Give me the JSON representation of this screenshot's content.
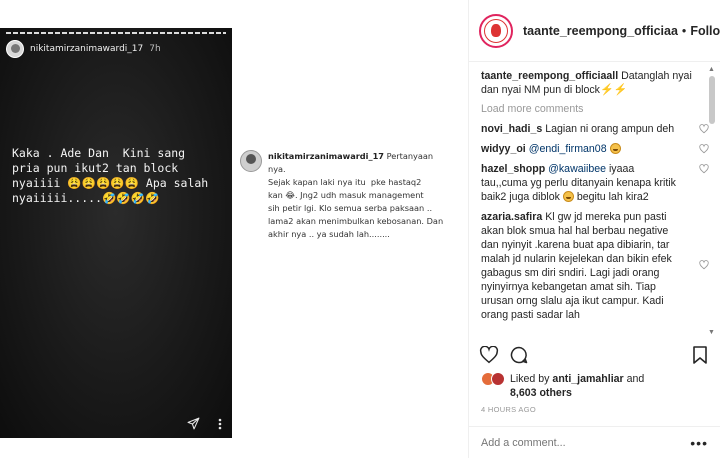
{
  "story": {
    "username": "nikitamirzanimawardi_17",
    "time": "7h",
    "text": "Kaka . Ade Dan  Kini sang\npria pun ikut2 tan block\nnyaiiii 😩😩😩😩😩 Apa salah\nnyaiiiii.....🤣🤣🤣🤣"
  },
  "embedded_comment": {
    "username": "nikitamirzanimawardi_17",
    "text": "Pertanyaan nya.\nSejak kapan laki nya itu  pke hastaq2\nkan 😂. Jng2 udh masuk management\nsih petir lgi. Klo semua serba paksaan ..\nlama2 akan menimbulkan kebosanan. Dan\nakhir nya .. ya sudah lah........"
  },
  "panel": {
    "username": "taante_reempong_officiaa",
    "dot": "•",
    "follow_label": "Following",
    "caption": {
      "username": "taante_reempong_officiaall",
      "text": "Datanglah nyai dan nyai NM pun di block",
      "bolts": "⚡⚡"
    },
    "load_more": "Load more comments",
    "comments": [
      {
        "username": "novi_hadi_s",
        "text": "Lagian ni orang ampun deh"
      },
      {
        "username": "widyy_oi",
        "mention": "@endi_firman08",
        "text": ""
      },
      {
        "username": "hazel_shopp",
        "mention": "@kawaiibee",
        "text": "iyaaa tau,,cuma yg perlu ditanyain kenapa kritik baik2 juga diblok",
        "text_after": "begitu lah kira2"
      },
      {
        "username": "azaria.safira",
        "text": "Kl gw jd mereka pun pasti akan blok smua hal hal berbau negative dan nyinyit .karena buat apa dibiarin, tar malah jd nularin kejelekan dan bikin efek gabagus sm diri sndiri. Lagi jadi orang nyinyirnya kebangetan amat sih. Tiap urusan orng slalu aja ikut campur. Kadi orang pasti sadar lah"
      }
    ],
    "likes": {
      "prefix": "Liked by",
      "user": "anti_jamahliar",
      "and": "and",
      "others": "8,603 others"
    },
    "time_ago": "4 HOURS AGO",
    "add_comment_placeholder": "Add a comment...",
    "more": "•••",
    "scroll_up": "▲",
    "scroll_down": "▼"
  }
}
